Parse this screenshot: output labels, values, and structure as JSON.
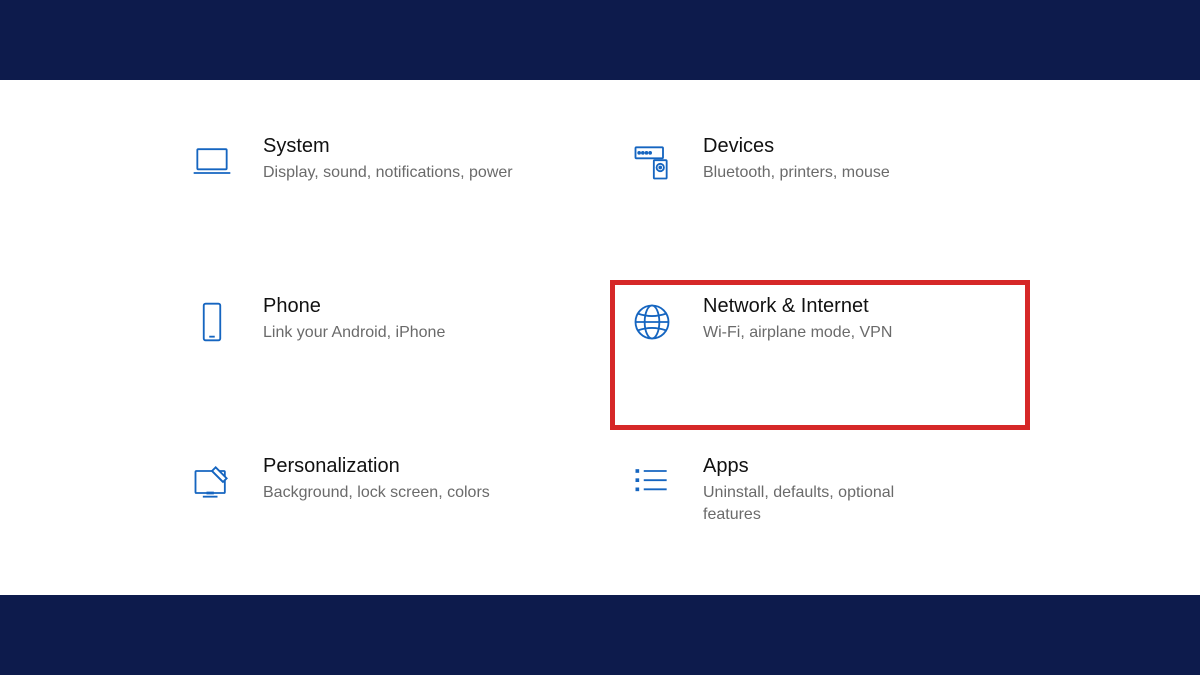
{
  "colors": {
    "band": "#0d1b4c",
    "icon": "#1565c0",
    "highlight_border": "#d62828"
  },
  "highlighted_index": 3,
  "categories": [
    {
      "id": "system",
      "title": "System",
      "desc": "Display, sound, notifications, power",
      "icon": "laptop-icon"
    },
    {
      "id": "devices",
      "title": "Devices",
      "desc": "Bluetooth, printers, mouse",
      "icon": "devices-icon"
    },
    {
      "id": "phone",
      "title": "Phone",
      "desc": "Link your Android, iPhone",
      "icon": "phone-icon"
    },
    {
      "id": "network",
      "title": "Network & Internet",
      "desc": "Wi-Fi, airplane mode, VPN",
      "icon": "globe-icon"
    },
    {
      "id": "personalization",
      "title": "Personalization",
      "desc": "Background, lock screen, colors",
      "icon": "personalization-icon"
    },
    {
      "id": "apps",
      "title": "Apps",
      "desc": "Uninstall, defaults, optional features",
      "icon": "apps-icon"
    }
  ]
}
